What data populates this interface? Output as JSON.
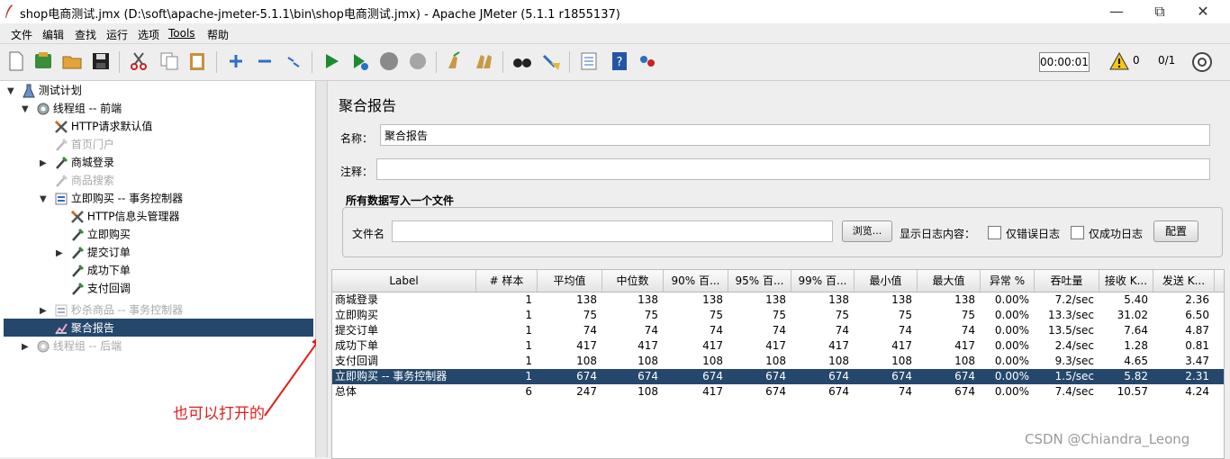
{
  "window": {
    "title": "shop电商测试.jmx (D:\\soft\\apache-jmeter-5.1.1\\bin\\shop电商测试.jmx) - Apache JMeter (5.1.1 r1855137)",
    "minimize": "—",
    "maximize": "⧉",
    "close": "✕"
  },
  "menu": [
    "文件",
    "编辑",
    "查找",
    "运行",
    "选项",
    "Tools",
    "帮助"
  ],
  "toolbar": {
    "timer": "00:00:01",
    "warnings": "0",
    "threads": "0/1"
  },
  "tree": [
    {
      "label": "测试计划",
      "icon": "test-plan-icon",
      "toggle": "▼",
      "disabled": false
    },
    {
      "label": "线程组 -- 前端",
      "icon": "thread-group-gear-icon",
      "toggle": "▼",
      "disabled": false
    },
    {
      "label": "HTTP请求默认值",
      "icon": "config-tools-icon",
      "toggle": "",
      "disabled": false
    },
    {
      "label": "首页门户",
      "icon": "sampler-pipette-icon",
      "toggle": "",
      "disabled": true
    },
    {
      "label": "商城登录",
      "icon": "sampler-pipette-icon",
      "toggle": "▶",
      "disabled": false
    },
    {
      "label": "商品搜索",
      "icon": "sampler-pipette-icon",
      "toggle": "",
      "disabled": true
    },
    {
      "label": "立即购买 -- 事务控制器",
      "icon": "transaction-controller-icon",
      "toggle": "▼",
      "disabled": false
    },
    {
      "label": "HTTP信息头管理器",
      "icon": "config-tools-icon",
      "toggle": "",
      "disabled": false
    },
    {
      "label": "立即购买",
      "icon": "sampler-pipette-icon",
      "toggle": "",
      "disabled": false
    },
    {
      "label": "提交订单",
      "icon": "sampler-pipette-icon",
      "toggle": "▶",
      "disabled": false
    },
    {
      "label": "成功下单",
      "icon": "sampler-pipette-icon",
      "toggle": "",
      "disabled": false
    },
    {
      "label": "支付回调",
      "icon": "sampler-pipette-icon",
      "toggle": "",
      "disabled": false
    },
    {
      "label": "秒杀商品 -- 事务控制器",
      "icon": "transaction-controller-icon",
      "toggle": "▶",
      "disabled": true
    },
    {
      "label": "聚合报告",
      "icon": "report-chart-icon",
      "toggle": "",
      "disabled": false,
      "selected": true
    },
    {
      "label": "线程组 -- 后端",
      "icon": "thread-group-gear-icon",
      "toggle": "▶",
      "disabled": true
    }
  ],
  "panel": {
    "title": "聚合报告",
    "name_label": "名称：",
    "name_value": "聚合报告",
    "comment_label": "注释：",
    "comment_value": "",
    "group_title": "所有数据写入一个文件",
    "file_label": "文件名",
    "file_value": "",
    "browse_label": "浏览...",
    "log_label": "显示日志内容：",
    "errors_only_label": "仅错误日志",
    "success_only_label": "仅成功日志",
    "configure_label": "配置"
  },
  "table": {
    "columns": [
      "Label",
      "# 样本",
      "平均值",
      "中位数",
      "90% 百...",
      "95% 百...",
      "99% 百...",
      "最小值",
      "最大值",
      "异常 %",
      "吞吐量",
      "接收 K...",
      "发送 K..."
    ],
    "rows": [
      [
        "商城登录",
        "1",
        "138",
        "138",
        "138",
        "138",
        "138",
        "138",
        "138",
        "0.00%",
        "7.2/sec",
        "5.40",
        "2.36"
      ],
      [
        "立即购买",
        "1",
        "75",
        "75",
        "75",
        "75",
        "75",
        "75",
        "75",
        "0.00%",
        "13.3/sec",
        "31.02",
        "6.50"
      ],
      [
        "提交订单",
        "1",
        "74",
        "74",
        "74",
        "74",
        "74",
        "74",
        "74",
        "0.00%",
        "13.5/sec",
        "7.64",
        "4.87"
      ],
      [
        "成功下单",
        "1",
        "417",
        "417",
        "417",
        "417",
        "417",
        "417",
        "417",
        "0.00%",
        "2.4/sec",
        "1.28",
        "0.81"
      ],
      [
        "支付回调",
        "1",
        "108",
        "108",
        "108",
        "108",
        "108",
        "108",
        "108",
        "0.00%",
        "9.3/sec",
        "4.65",
        "3.47"
      ],
      [
        "立即购买 -- 事务控制器",
        "1",
        "674",
        "674",
        "674",
        "674",
        "674",
        "674",
        "674",
        "0.00%",
        "1.5/sec",
        "5.82",
        "2.31"
      ],
      [
        "总体",
        "6",
        "247",
        "108",
        "417",
        "674",
        "674",
        "74",
        "674",
        "0.00%",
        "7.4/sec",
        "10.57",
        "4.24"
      ]
    ],
    "selected_row": 5
  },
  "annotation": "也可以打开的",
  "watermark": "CSDN @Chiandra_Leong",
  "colors": {
    "selection": "#25476c",
    "annotation": "#e0201b"
  }
}
